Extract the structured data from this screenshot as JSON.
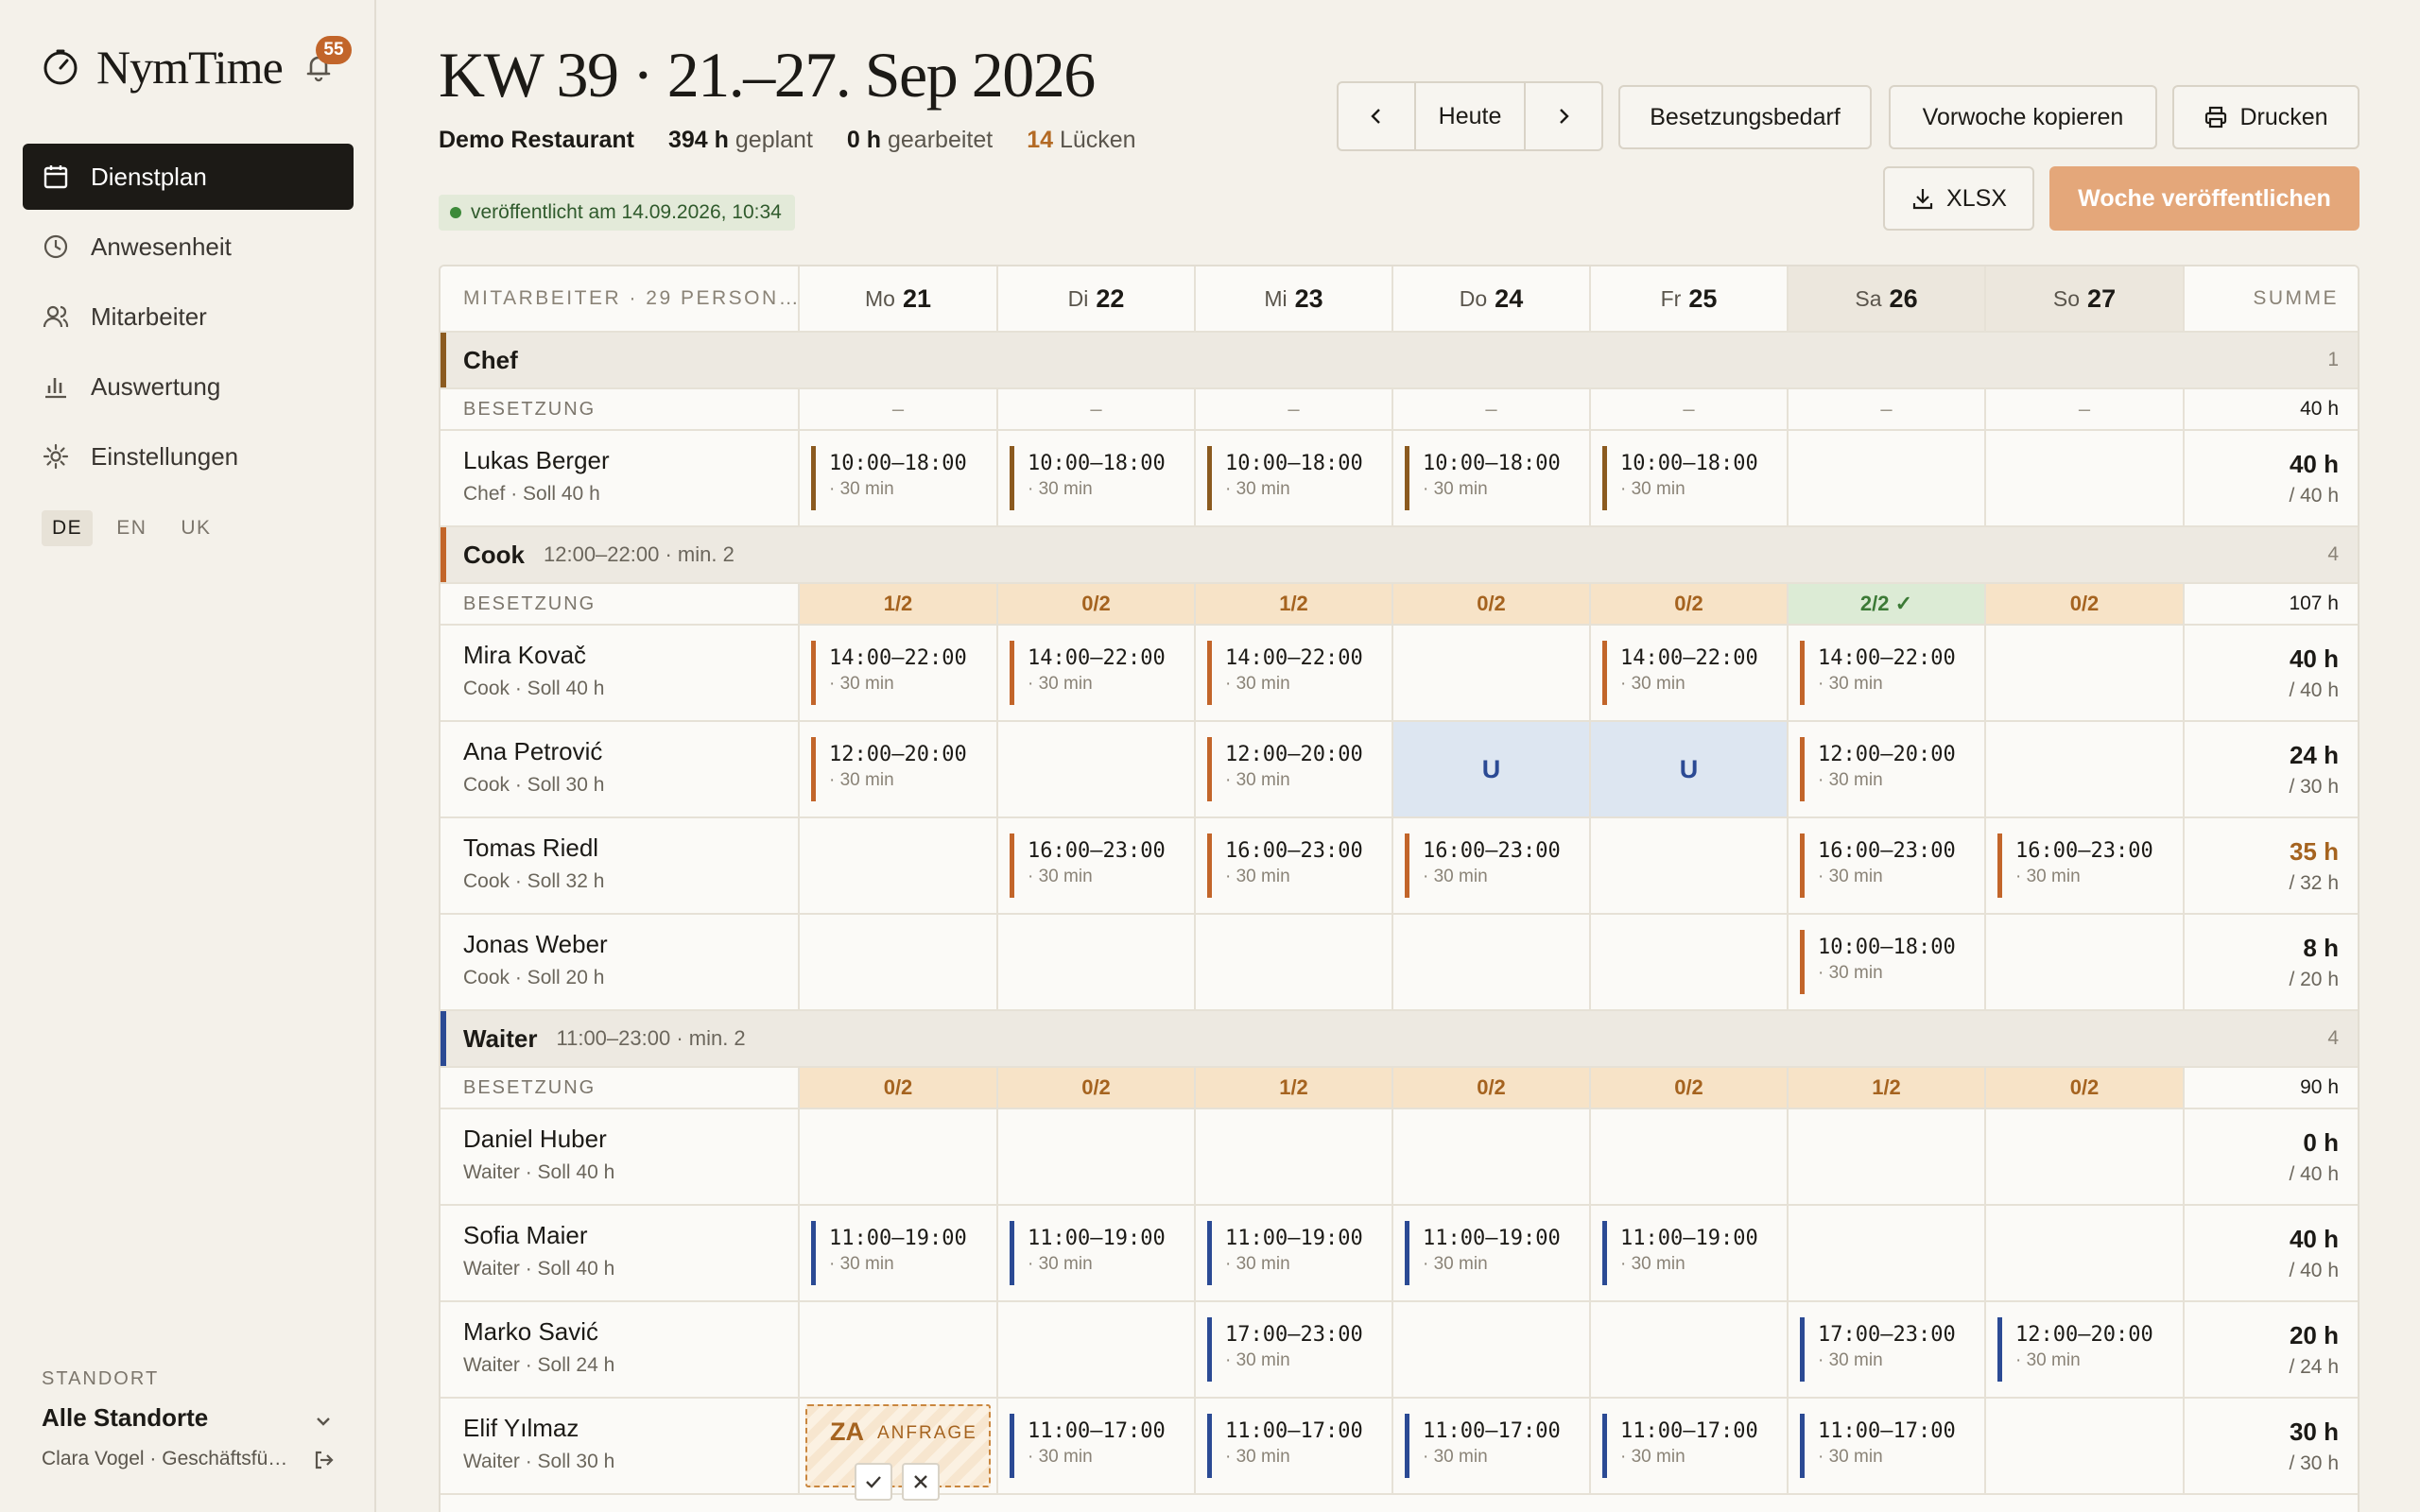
{
  "app": {
    "name": "NymTime",
    "notification_count": "55"
  },
  "sidebar": {
    "nav": [
      {
        "label": "Dienstplan",
        "icon": "calendar-icon",
        "active": true
      },
      {
        "label": "Anwesenheit",
        "icon": "clock-icon",
        "active": false
      },
      {
        "label": "Mitarbeiter",
        "icon": "users-icon",
        "active": false
      },
      {
        "label": "Auswertung",
        "icon": "bar-chart-icon",
        "active": false
      },
      {
        "label": "Einstellungen",
        "icon": "sun-gear-icon",
        "active": false
      }
    ],
    "languages": [
      {
        "label": "DE",
        "active": true
      },
      {
        "label": "EN",
        "active": false
      },
      {
        "label": "UK",
        "active": false
      }
    ],
    "standort_label": "STANDORT",
    "standort_value": "Alle Standorte",
    "user": "Clara Vogel · Geschäftsführung"
  },
  "header": {
    "title": "KW 39 · 21.–27. Sep 2026",
    "restaurant": "Demo Restaurant",
    "planned_value": "394 h",
    "planned_label": "geplant",
    "worked_value": "0 h",
    "worked_label": "gearbeitet",
    "gaps_value": "14",
    "gaps_label": "Lücken",
    "published": "veröffentlicht am 14.09.2026, 10:34",
    "today_label": "Heute",
    "besetzungsbedarf_label": "Besetzungsbedarf",
    "copy_week_label": "Vorwoche kopieren",
    "print_label": "Drucken",
    "xlsx_label": "XLSX",
    "publish_label": "Woche veröffentlichen"
  },
  "colors": {
    "accent": "#c2652a",
    "chef": "#8b5a1f",
    "cook": "#c2652a",
    "waiter": "#2b4a94",
    "publish_button": "#e4a77a"
  },
  "grid": {
    "employee_header": "MITARBEITER · 29 PERSON…",
    "sum_header": "SUMME",
    "besetzung_label": "BESETZUNG",
    "days": [
      {
        "name": "Mo",
        "date": "21",
        "weekend": false
      },
      {
        "name": "Di",
        "date": "22",
        "weekend": false
      },
      {
        "name": "Mi",
        "date": "23",
        "weekend": false
      },
      {
        "name": "Do",
        "date": "24",
        "weekend": false
      },
      {
        "name": "Fr",
        "date": "25",
        "weekend": false
      },
      {
        "name": "Sa",
        "date": "26",
        "weekend": true
      },
      {
        "name": "So",
        "date": "27",
        "weekend": true
      }
    ],
    "groups": [
      {
        "name": "Chef",
        "role": "chef",
        "info": "",
        "count": "1",
        "besetzung": [
          "–",
          "–",
          "–",
          "–",
          "–",
          "–",
          "–"
        ],
        "besetzung_state": [
          "none",
          "none",
          "none",
          "none",
          "none",
          "none",
          "none"
        ],
        "besetzung_sum": "40 h",
        "employees": [
          {
            "name": "Lukas Berger",
            "sub": "Chef · Soll 40 h",
            "hours": "40 h",
            "target": "/ 40 h",
            "over": false,
            "shifts": [
              {
                "time": "10:00–18:00",
                "break": "· 30 min"
              },
              {
                "time": "10:00–18:00",
                "break": "· 30 min"
              },
              {
                "time": "10:00–18:00",
                "break": "· 30 min"
              },
              {
                "time": "10:00–18:00",
                "break": "· 30 min"
              },
              {
                "time": "10:00–18:00",
                "break": "· 30 min"
              },
              null,
              null
            ]
          }
        ]
      },
      {
        "name": "Cook",
        "role": "cook",
        "info": "12:00–22:00 · min. 2",
        "count": "4",
        "besetzung": [
          "1/2",
          "0/2",
          "1/2",
          "0/2",
          "0/2",
          "2/2 ✓",
          "0/2"
        ],
        "besetzung_state": [
          "under",
          "under",
          "under",
          "under",
          "under",
          "ok",
          "under"
        ],
        "besetzung_sum": "107 h",
        "employees": [
          {
            "name": "Mira Kovač",
            "sub": "Cook · Soll 40 h",
            "hours": "40 h",
            "target": "/ 40 h",
            "over": false,
            "shifts": [
              {
                "time": "14:00–22:00",
                "break": "· 30 min"
              },
              {
                "time": "14:00–22:00",
                "break": "· 30 min"
              },
              {
                "time": "14:00–22:00",
                "break": "· 30 min"
              },
              null,
              {
                "time": "14:00–22:00",
                "break": "· 30 min"
              },
              {
                "time": "14:00–22:00",
                "break": "· 30 min"
              },
              null
            ]
          },
          {
            "name": "Ana Petrović",
            "sub": "Cook · Soll 30 h",
            "hours": "24 h",
            "target": "/ 30 h",
            "over": false,
            "shifts": [
              {
                "time": "12:00–20:00",
                "break": "· 30 min"
              },
              null,
              {
                "time": "12:00–20:00",
                "break": "· 30 min"
              },
              {
                "absence": "U"
              },
              {
                "absence": "U"
              },
              {
                "time": "12:00–20:00",
                "break": "· 30 min"
              },
              null
            ]
          },
          {
            "name": "Tomas Riedl",
            "sub": "Cook · Soll 32 h",
            "hours": "35 h",
            "target": "/ 32 h",
            "over": true,
            "shifts": [
              null,
              {
                "time": "16:00–23:00",
                "break": "· 30 min"
              },
              {
                "time": "16:00–23:00",
                "break": "· 30 min"
              },
              {
                "time": "16:00–23:00",
                "break": "· 30 min"
              },
              null,
              {
                "time": "16:00–23:00",
                "break": "· 30 min"
              },
              {
                "time": "16:00–23:00",
                "break": "· 30 min"
              }
            ]
          },
          {
            "name": "Jonas Weber",
            "sub": "Cook · Soll 20 h",
            "hours": "8 h",
            "target": "/ 20 h",
            "over": false,
            "shifts": [
              null,
              null,
              null,
              null,
              null,
              {
                "time": "10:00–18:00",
                "break": "· 30 min"
              },
              null
            ]
          }
        ]
      },
      {
        "name": "Waiter",
        "role": "waiter",
        "info": "11:00–23:00 · min. 2",
        "count": "4",
        "besetzung": [
          "0/2",
          "0/2",
          "1/2",
          "0/2",
          "0/2",
          "1/2",
          "0/2"
        ],
        "besetzung_state": [
          "under",
          "under",
          "under",
          "under",
          "under",
          "under",
          "under"
        ],
        "besetzung_sum": "90 h",
        "employees": [
          {
            "name": "Daniel Huber",
            "sub": "Waiter · Soll 40 h",
            "hours": "0 h",
            "target": "/ 40 h",
            "over": false,
            "shifts": [
              null,
              null,
              null,
              null,
              null,
              null,
              null
            ]
          },
          {
            "name": "Sofia Maier",
            "sub": "Waiter · Soll 40 h",
            "hours": "40 h",
            "target": "/ 40 h",
            "over": false,
            "shifts": [
              {
                "time": "11:00–19:00",
                "break": "· 30 min"
              },
              {
                "time": "11:00–19:00",
                "break": "· 30 min"
              },
              {
                "time": "11:00–19:00",
                "break": "· 30 min"
              },
              {
                "time": "11:00–19:00",
                "break": "· 30 min"
              },
              {
                "time": "11:00–19:00",
                "break": "· 30 min"
              },
              null,
              null
            ]
          },
          {
            "name": "Marko Savić",
            "sub": "Waiter · Soll 24 h",
            "hours": "20 h",
            "target": "/ 24 h",
            "over": false,
            "shifts": [
              null,
              null,
              {
                "time": "17:00–23:00",
                "break": "· 30 min"
              },
              null,
              null,
              {
                "time": "17:00–23:00",
                "break": "· 30 min"
              },
              {
                "time": "12:00–20:00",
                "break": "· 30 min"
              }
            ]
          },
          {
            "name": "Elif Yılmaz",
            "sub": "Waiter · Soll 30 h",
            "hours": "30 h",
            "target": "/ 30 h",
            "over": false,
            "shifts": [
              {
                "request": "ZA",
                "request_label": "ANFRAGE"
              },
              {
                "time": "11:00–17:00",
                "break": "· 30 min"
              },
              {
                "time": "11:00–17:00",
                "break": "· 30 min"
              },
              {
                "time": "11:00–17:00",
                "break": "· 30 min"
              },
              {
                "time": "11:00–17:00",
                "break": "· 30 min"
              },
              {
                "time": "11:00–17:00",
                "break": "· 30 min"
              },
              null
            ]
          }
        ]
      }
    ]
  }
}
